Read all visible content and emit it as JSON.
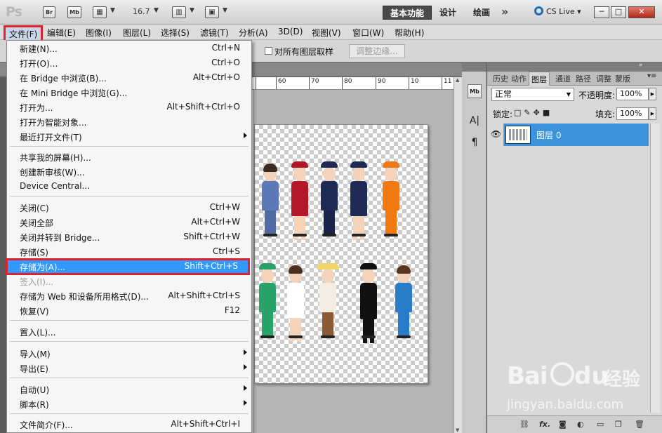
{
  "appbar": {
    "logo": "Ps",
    "bridge_btn": "Br",
    "mini_bridge_btn": "Mb",
    "zoom": "16.7",
    "workspaces": [
      "基本功能",
      "设计",
      "绘画"
    ],
    "more": "»",
    "cslive": "CS Live",
    "window_buttons": [
      "─",
      "□",
      "✕"
    ]
  },
  "menubar": [
    "文件(F)",
    "编辑(E)",
    "图像(I)",
    "图层(L)",
    "选择(S)",
    "滤镜(T)",
    "分析(A)",
    "3D(D)",
    "视图(V)",
    "窗口(W)",
    "帮助(H)"
  ],
  "options": {
    "sample_all_layers": "对所有图层取样",
    "refine_edge": "调整边缘..."
  },
  "ruler": [
    "60",
    "70",
    "80",
    "90",
    "10",
    "11"
  ],
  "file_menu": {
    "groups": [
      [
        {
          "label": "新建(N)...",
          "shortcut": "Ctrl+N"
        },
        {
          "label": "打开(O)...",
          "shortcut": "Ctrl+O"
        },
        {
          "label": "在 Bridge 中浏览(B)...",
          "shortcut": "Alt+Ctrl+O"
        },
        {
          "label": "在 Mini Bridge 中浏览(G)...",
          "shortcut": ""
        },
        {
          "label": "打开为...",
          "shortcut": "Alt+Shift+Ctrl+O"
        },
        {
          "label": "打开为智能对象...",
          "shortcut": ""
        },
        {
          "label": "最近打开文件(T)",
          "shortcut": "",
          "submenu": true
        }
      ],
      [
        {
          "label": "共享我的屏幕(H)...",
          "shortcut": ""
        },
        {
          "label": "创建新审核(W)...",
          "shortcut": ""
        },
        {
          "label": "Device Central...",
          "shortcut": ""
        }
      ],
      [
        {
          "label": "关闭(C)",
          "shortcut": "Ctrl+W"
        },
        {
          "label": "关闭全部",
          "shortcut": "Alt+Ctrl+W"
        },
        {
          "label": "关闭并转到 Bridge...",
          "shortcut": "Shift+Ctrl+W"
        },
        {
          "label": "存储(S)",
          "shortcut": "Ctrl+S"
        },
        {
          "label": "存储为(A)...",
          "shortcut": "Shift+Ctrl+S",
          "highlighted": true
        },
        {
          "label": "签入(I)...",
          "shortcut": "",
          "disabled": true
        },
        {
          "label": "存储为 Web 和设备所用格式(D)...",
          "shortcut": "Alt+Shift+Ctrl+S"
        },
        {
          "label": "恢复(V)",
          "shortcut": "F12"
        }
      ],
      [
        {
          "label": "置入(L)...",
          "shortcut": ""
        }
      ],
      [
        {
          "label": "导入(M)",
          "shortcut": "",
          "submenu": true
        },
        {
          "label": "导出(E)",
          "shortcut": "",
          "submenu": true
        }
      ],
      [
        {
          "label": "自动(U)",
          "shortcut": "",
          "submenu": true
        },
        {
          "label": "脚本(R)",
          "shortcut": "",
          "submenu": true
        }
      ],
      [
        {
          "label": "文件简介(F)...",
          "shortcut": "Alt+Shift+Ctrl+I"
        }
      ]
    ]
  },
  "layers_panel": {
    "tabs": [
      "历史",
      "动作",
      "图层",
      "通道",
      "路径",
      "调整",
      "蒙版"
    ],
    "active_tab": "图层",
    "blend_mode": "正常",
    "opacity_label": "不透明度:",
    "opacity": "100%",
    "lock_label": "锁定:",
    "fill_label": "填充:",
    "fill": "100%",
    "layer_name": "图层 0",
    "footer_icons": [
      "link-icon",
      "fx-icon",
      "mask-icon",
      "adjustment-icon",
      "group-icon",
      "new-layer-icon",
      "trash-icon"
    ]
  },
  "watermark": {
    "brand": "Bai",
    "brand2": "du",
    "cn": "经验",
    "url": "jingyan.baidu.com"
  },
  "colors": {
    "highlight": "#3399ff",
    "annotation_red": "#e0232a",
    "layer_selected": "#3c93dc"
  }
}
